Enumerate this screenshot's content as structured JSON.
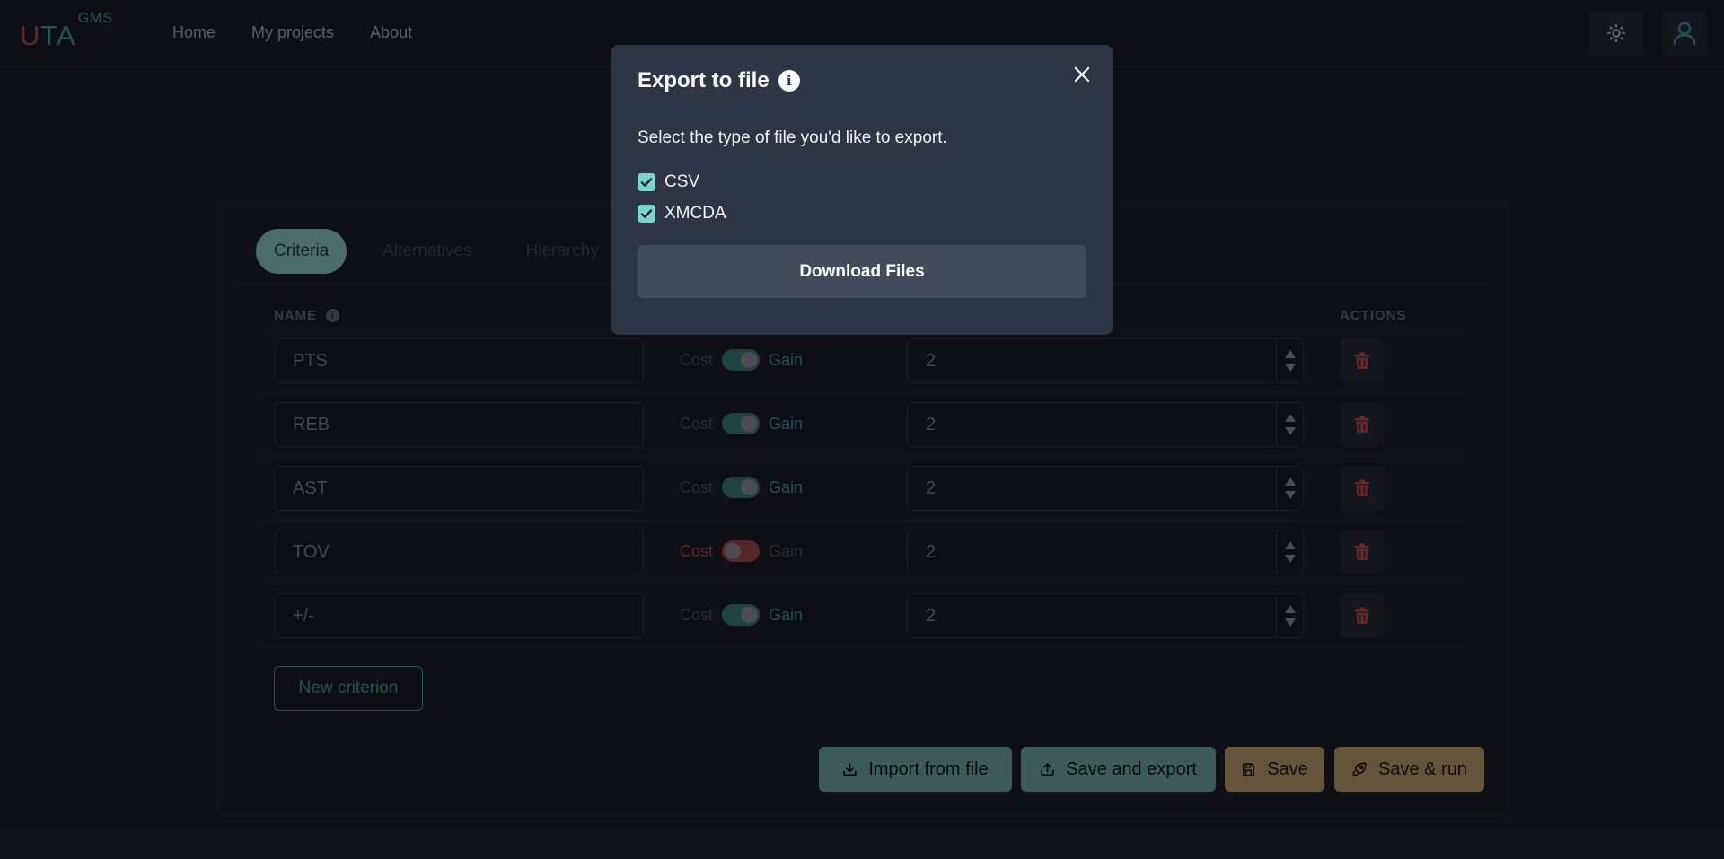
{
  "navbar": {
    "logo_u": "U",
    "logo_ta": "TA",
    "logo_sup": "GMS",
    "links": [
      "Home",
      "My projects",
      "About"
    ],
    "theme_icon": "sun-icon",
    "user_icon": "user-icon"
  },
  "tabs": [
    {
      "label": "Criteria",
      "active": true
    },
    {
      "label": "Alternatives",
      "active": false
    },
    {
      "label": "Hierarchy",
      "active": false
    }
  ],
  "columns": {
    "name": "NAME",
    "actions": "ACTIONS"
  },
  "criteria": [
    {
      "name": "PTS",
      "type": "gain",
      "value": "2"
    },
    {
      "name": "REB",
      "type": "gain",
      "value": "2"
    },
    {
      "name": "AST",
      "type": "gain",
      "value": "2"
    },
    {
      "name": "TOV",
      "type": "cost",
      "value": "2"
    },
    {
      "name": "+/-",
      "type": "gain",
      "value": "2"
    }
  ],
  "labels": {
    "cost": "Cost",
    "gain": "Gain",
    "new_criterion": "New criterion"
  },
  "actions": {
    "import": "Import from file",
    "save_export": "Save and export",
    "save": "Save",
    "save_run": "Save & run"
  },
  "modal": {
    "title": "Export to file",
    "description": "Select the type of file you'd like to export.",
    "options": [
      {
        "label": "CSV",
        "checked": true
      },
      {
        "label": "XMCDA",
        "checked": true
      }
    ],
    "download": "Download Files"
  },
  "colors": {
    "accent_teal": "#3f9a96",
    "cost_red": "#b24a4e",
    "gold": "#b79a6a",
    "checkbox": "#79d4cc"
  }
}
